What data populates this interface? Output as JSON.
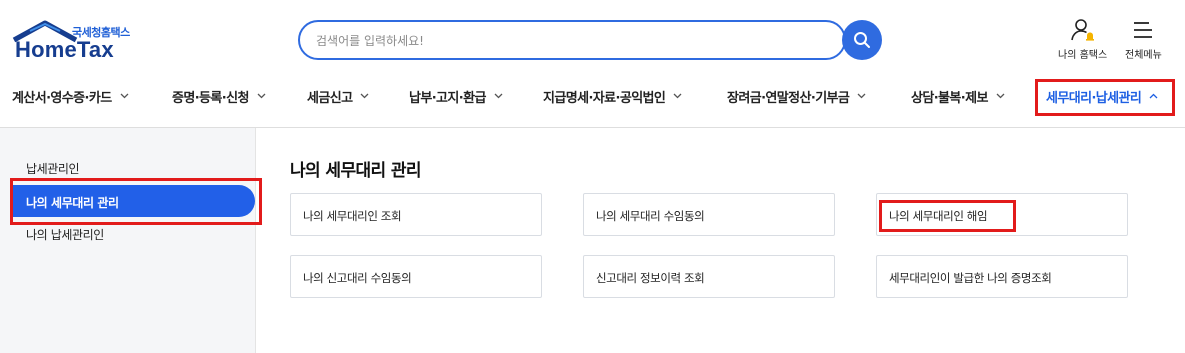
{
  "brand": {
    "sub": "국세청홈택스",
    "main": "HomeTax"
  },
  "search": {
    "placeholder": "검색어를 입력하세요!"
  },
  "utilities": {
    "my_hometax": "나의 홈택스",
    "all_menu": "전체메뉴"
  },
  "gnb": {
    "items": [
      {
        "label": "계산서·영수증·카드"
      },
      {
        "label": "증명·등록·신청"
      },
      {
        "label": "세금신고"
      },
      {
        "label": "납부·고지·환급"
      },
      {
        "label": "지급명세·자료·공익법인"
      },
      {
        "label": "장려금·연말정산·기부금"
      },
      {
        "label": "상담·불복·제보"
      },
      {
        "label": "세무대리·납세관리",
        "active": true
      }
    ]
  },
  "sidebar": {
    "items": [
      {
        "label": "납세관리인"
      },
      {
        "label": "나의 세무대리 관리",
        "active": true
      },
      {
        "label": "나의 납세관리인"
      }
    ]
  },
  "content": {
    "title": "나의 세무대리 관리",
    "cards": [
      {
        "label": "나의 세무대리인 조회"
      },
      {
        "label": "나의 세무대리 수임동의"
      },
      {
        "label": "나의 세무대리인 해임"
      },
      {
        "label": "나의 신고대리 수임동의"
      },
      {
        "label": "신고대리 정보이력 조회"
      },
      {
        "label": "세무대리인이 발급한 나의 증명조회"
      }
    ]
  },
  "colors": {
    "accent": "#2f6be0",
    "active_nav": "#1d5fe3",
    "highlight": "#e21b1b",
    "sidebar_active": "#2260e8",
    "logo": "#163d8f"
  },
  "icons": {
    "search": "search-icon",
    "my_hometax": "user-bell-icon",
    "all_menu": "hamburger-icon",
    "chevron": "chevron-down-icon",
    "chevron_active": "chevron-up-icon"
  }
}
